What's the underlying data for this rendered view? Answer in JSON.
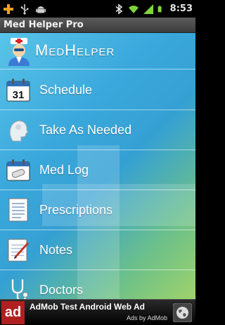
{
  "status_bar": {
    "time": "8:53",
    "left_icons": [
      "plus-icon",
      "usb-icon",
      "android-icon"
    ],
    "right_icons": [
      "bluetooth-icon",
      "wifi-icon",
      "signal-icon",
      "battery-icon"
    ]
  },
  "app": {
    "title": "Med Helper Pro",
    "logo_text": "MedHelper"
  },
  "menu": {
    "items": [
      {
        "label": "Schedule",
        "icon": "calendar-icon",
        "icon_text": "31"
      },
      {
        "label": "Take As Needed",
        "icon": "head-icon"
      },
      {
        "label": "Med Log",
        "icon": "pill-log-icon"
      },
      {
        "label": "Prescriptions",
        "icon": "document-icon"
      },
      {
        "label": "Notes",
        "icon": "notepad-icon"
      },
      {
        "label": "Doctors",
        "icon": "stethoscope-icon"
      }
    ]
  },
  "ad": {
    "logo_text": "ad",
    "title": "AdMob Test Android Web Ad",
    "subtitle": "Ads by AdMob",
    "icon": "globe-icon"
  },
  "colors": {
    "status_bar_bg": "#000000",
    "title_bar_bg": "#4a4a4a",
    "content_gradient_top": "#59c4e8",
    "content_gradient_bottom": "#9fd36a",
    "ad_logo_bg": "#b0201f"
  }
}
